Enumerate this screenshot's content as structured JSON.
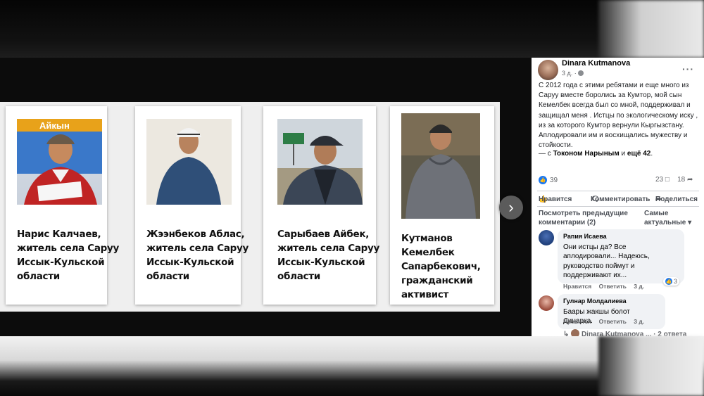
{
  "carousel": {
    "cards": [
      {
        "caption": "Нарис Калчаев, житель села Саруу Иссык-Кульской области",
        "photo_banner": "Айкын"
      },
      {
        "caption": "Жээнбеков Аблас, житель села Саруу Иссык-Кульской области"
      },
      {
        "caption": "Сарыбаев Айбек, житель села Саруу Иссык-Кульской области"
      },
      {
        "caption": "Кутманов Кемелбек Сапарбекович, гражданский активист"
      }
    ],
    "next_icon": "chevron-right-icon"
  },
  "post": {
    "author": "Dinara Kutmanova",
    "time": "3 д. ·",
    "text": "С 2012 года с этими ребятами и еще много из Саруу вместе боролись за Кумтор, мой сын Кемелбек всегда был со мной, поддерживал и защищал меня . Истцы по экологическому иску , из за которого Кумтор вернули Кыргызстану. Аплодировали им и восхищались мужеству и стойкости.",
    "tagged_prefix": "— с",
    "tagged_name": "Токоном Нарыным",
    "tagged_and": "и",
    "tagged_more": "ещё 42",
    "tagged_end": ".",
    "likes": "39",
    "comments_count": "23",
    "shares_count": "18",
    "actions": {
      "like": "Нравится",
      "comment": "Комментировать",
      "share": "Поделиться"
    },
    "prev_comments": "Посмотреть предыдущие комментарии (2)",
    "sort": "Самые актуальные"
  },
  "comments": [
    {
      "name": "Рапия Исаева",
      "text": "Они истцы да? Все аплодировали... Надеюсь, руководство поймут и поддерживают их...",
      "like": "Нравится",
      "reply": "Ответить",
      "time": "3 д.",
      "reactions": "3"
    },
    {
      "name": "Гулнар Молдалиева",
      "text": "Баары жакшы болот Динарка.",
      "like": "Нравится",
      "reply": "Ответить",
      "time": "3 д."
    }
  ],
  "reply_line": {
    "author": "Dinara Kutmanova ...",
    "count": "· 2 ответа"
  },
  "colors": {
    "accent": "#1877f2",
    "panel_bg": "#ffffff",
    "bubble_bg": "#f0f2f5"
  }
}
